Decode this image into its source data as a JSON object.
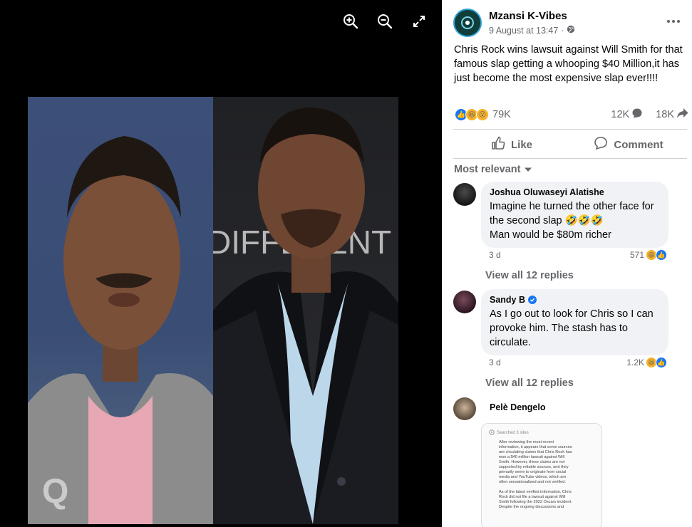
{
  "viewer": {
    "tools": [
      {
        "name": "zoom-in-icon"
      },
      {
        "name": "zoom-out-icon"
      },
      {
        "name": "fullscreen-icon"
      }
    ],
    "photo_watermark": "DIFFERENT",
    "photo_logo": "Q"
  },
  "post": {
    "page_name": "Mzansi K-Vibes",
    "timestamp": "9 August at 13:47",
    "meta_sep": "·",
    "audience_icon": "globe-icon",
    "text": "Chris Rock wins lawsuit against Will Smith for that famous slap getting a whooping $40 Million,it has just become the most expensive slap ever!!!!",
    "reactions_count": "79K",
    "comments_count": "12K",
    "shares_count": "18K",
    "like_label": "Like",
    "comment_label": "Comment"
  },
  "comments_section": {
    "sort_label": "Most relevant",
    "comments": [
      {
        "author": "Joshua Oluwaseyi Alatishe",
        "line1": "Imagine he turned the other face for",
        "line2": "the second slap 🤣🤣🤣",
        "line3": "Man would be $80m richer",
        "age": "3 d",
        "reacts": "571",
        "view_replies": "View all 12 replies"
      },
      {
        "author": "Sandy B",
        "verified": true,
        "text": "As I go out to look for Chris so I can provoke him. The stash has to circulate.",
        "age": "3 d",
        "reacts": "1.2K",
        "view_replies": "View all 12 replies"
      },
      {
        "author": "Pelè Dengelo",
        "image": {
          "header": "Searched 3 sites",
          "body": "After reviewing the most recent\ninformation, it appears that some sources\nare circulating claims that Chris Rock has\nwon a $40 million lawsuit against Will\nSmith. However, these claims are not\nsupported by reliable sources, and they\nprimarily seem to originate from social\nmedia and YouTube videos, which are\noften sensationalized and not verified.\n\nAs of the latest verified information, Chris\nRock did not file a lawsuit against Will\nSmith following the 2022 Oscars incident.\nDespite the ongoing discussions and"
        }
      }
    ]
  },
  "colors": {
    "accent": "#1877f2",
    "secondary_text": "#65676b",
    "bubble": "#f0f2f5"
  }
}
